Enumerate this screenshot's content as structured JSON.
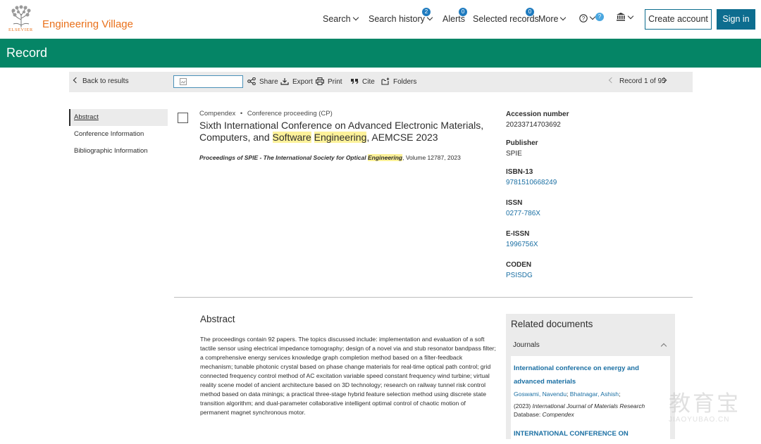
{
  "header": {
    "logo_wordmark": "ELSEVIER",
    "brand": "Engineering Village",
    "nav": [
      {
        "label": "Search",
        "badge": null
      },
      {
        "label": "Search history",
        "badge": "2"
      },
      {
        "label": "Alerts",
        "badge": "0"
      },
      {
        "label": "Selected records",
        "badge": "0"
      },
      {
        "label": "More",
        "badge": null
      }
    ],
    "help_badge": "?",
    "create_account": "Create account",
    "sign_in": "Sign in"
  },
  "band": {
    "title": "Record"
  },
  "toolbar": {
    "back": "Back to results",
    "share": "Share",
    "export": "Export",
    "print": "Print",
    "cite": "Cite",
    "folders": "Folders",
    "record_counter": "Record 1 of 95"
  },
  "left_nav": [
    "Abstract",
    "Conference Information",
    "Bibliographic Information"
  ],
  "record": {
    "database": "Compendex",
    "doc_type": "Conference proceeding (CP)",
    "title_before": "Sixth International Conference on Advanced Electronic Materials, Computers, and ",
    "title_hl1": "Software",
    "title_hl2": "Engineering",
    "title_after": ", AEMCSE 2023",
    "source_before": "Proceedings of SPIE - The International Society for Optical ",
    "source_hl": "Engineering",
    "source_after": ", Volume 12787, 2023"
  },
  "info": [
    {
      "label": "Accession number",
      "value": "20233714703692",
      "link": false
    },
    {
      "label": "Publisher",
      "value": "SPIE",
      "link": false
    },
    {
      "label": "ISBN-13",
      "value": "9781510668249",
      "link": true
    },
    {
      "label": "ISSN",
      "value": "0277-786X",
      "link": true
    },
    {
      "label": "E-ISSN",
      "value": "1996756X",
      "link": true
    },
    {
      "label": "CODEN",
      "value": "PSISDG",
      "link": true
    }
  ],
  "abstract": {
    "heading": "Abstract",
    "text": "The proceedings contain 92 papers. The topics discussed include: implementation and evaluation of a soft tactile sensor using electrical impedance tomography; design of a novel via and stub resonator bandpass filter; a comprehensive energy services knowledge graph completion method based on a filter-feedback mechanism; tunable photonic crystal based on phase change materials for real-time optical path control; grid connected frequency control method of AC excitation variable speed constant frequency wind turbine; virtual reality scene model of ancient architecture based on 3D technology; research on railway tunnel risk control method based on data minings; a practical three-stage hybrid feature selection method using discrete state transition algorithm; and dual-parameter collaborative intelligent optimal control of chaotic motion of permanent magnet synchronous motor."
  },
  "related": {
    "heading": "Related documents",
    "section": "Journals",
    "doc1_title": "International conference on energy and advanced materials",
    "author1": "Goswami, Navendu",
    "author2": "Bhatnagar, Ashish",
    "year": "(2023)",
    "journal": "International Journal of Materials Research",
    "database_label": "Database:",
    "database": "Compendex",
    "doc2_title": "INTERNATIONAL CONFERENCE ON"
  },
  "watermark": {
    "big": "教育宝",
    "small": "JIAOYUBAO.CN"
  }
}
